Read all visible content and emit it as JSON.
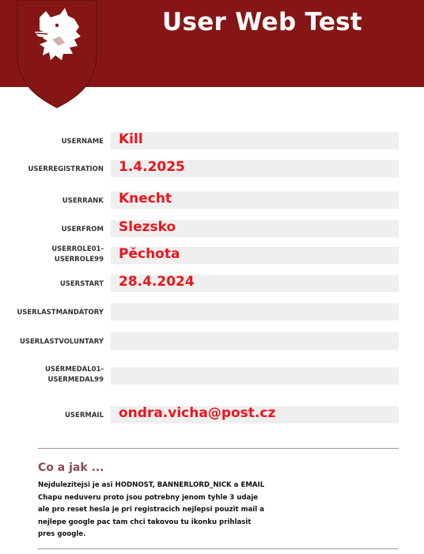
{
  "header": {
    "title": "User Web Test",
    "logo_icon": "wolf-head-shield-icon",
    "banner_color": "#861616"
  },
  "fields": [
    {
      "label": "USERNAME",
      "value": "Kill"
    },
    {
      "label": "USERREGISTRATION",
      "value": "1.4.2025"
    },
    {
      "label": "USERRANK",
      "value": "Knecht"
    },
    {
      "label": "USERFROM",
      "value": "Slezsko"
    },
    {
      "label1": "USERROLE01-",
      "label2": "USERROLE99",
      "value": "Pěchota"
    },
    {
      "label": "USERSTART",
      "value": "28.4.2024"
    },
    {
      "label": "USERLASTMANDATORY",
      "value": ""
    },
    {
      "label": "USERLASTVOLUNTARY",
      "value": ""
    },
    {
      "label1": "USERMEDAL01-",
      "label2": "USERMEDAL99",
      "value": ""
    },
    {
      "label": "USERMAIL",
      "value": "ondra.vicha@post.cz"
    }
  ],
  "colon": ":",
  "info": {
    "title": "Co a jak ...",
    "lines": [
      "Nejdulezitejsi je asi HODNOST, BANNERLORD_NICK a EMAIL",
      "Chapu neduveru proto jsou potrebny jenom tyhle 3 udaje",
      "ale pro reset hesla je pri registracich nejlepsi pouzit mail a",
      "nejlepe google pac tam chci takovou tu ikonku prihlasit",
      "pres google."
    ]
  },
  "value_color": "#e8161a"
}
